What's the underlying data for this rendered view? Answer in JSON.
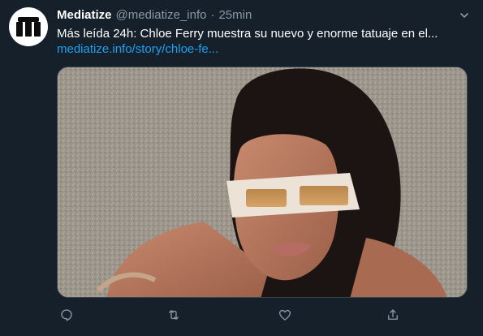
{
  "tweet": {
    "author_name": "Mediatize",
    "handle": "@mediatize_info",
    "separator": "·",
    "time": "25min",
    "text": "Más leída 24h: Chloe Ferry muestra su nuevo y enorme tatuaje en el...",
    "link": "mediatize.info/story/chloe-fe..."
  },
  "icons": {
    "avatar": "mediatize-logo",
    "more": "chevron-down-icon",
    "reply": "reply-icon",
    "retweet": "retweet-icon",
    "like": "heart-icon",
    "share": "share-icon"
  },
  "colors": {
    "background": "#15202b",
    "text_primary": "#ffffff",
    "text_secondary": "#8899a6",
    "link": "#1da1f2",
    "border": "#38444d"
  }
}
